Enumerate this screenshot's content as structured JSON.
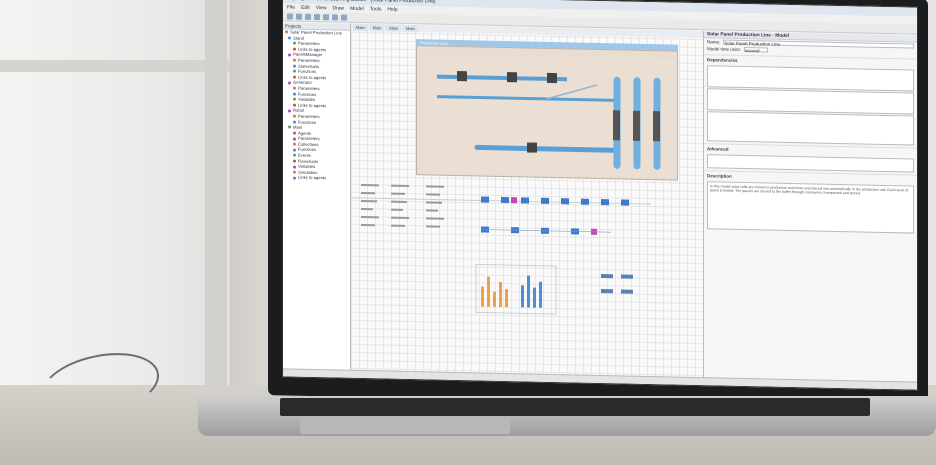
{
  "ide": {
    "title": "AnyLogic Personal Learning Edition - [Solar Panel Production Line]",
    "menu": [
      "File",
      "Edit",
      "View",
      "Draw",
      "Model",
      "Tools",
      "Help"
    ],
    "tabs": [
      "Projects",
      "Palette",
      "Main",
      "Main",
      "Main",
      "Main"
    ],
    "model_title": "Solar Panel Production Line",
    "model_subtitle": "Production Line",
    "tree": [
      "Solar Panel Production Line",
      "Stand",
      "Parameters",
      "Links to agents",
      "PanelsManager",
      "Parameters",
      "Statecharts",
      "Functions",
      "Links to agents",
      "Generator",
      "Parameters",
      "Functions",
      "Variables",
      "Links to agents",
      "Robot",
      "Parameters",
      "Functions",
      "Main",
      "Agents",
      "Parameters",
      "Collections",
      "Functions",
      "Events",
      "Flowcharts",
      "Variables",
      "Simulation",
      "Links to agents"
    ],
    "properties": {
      "header": "Solar Panel Production Line - Model",
      "name_label": "Name:",
      "name_value": "Solar Panel Production Line",
      "units_label": "Model time units:",
      "units_value": "second",
      "dependencies": "Dependencies",
      "advanced": "Advanced",
      "description": "Description",
      "description_text": "In this model solar cells are moved to production machines and placed one automatically in the production unit. Each level of panel is tested. The panels are moved to the buffer through conveyors, transported and stored."
    }
  }
}
